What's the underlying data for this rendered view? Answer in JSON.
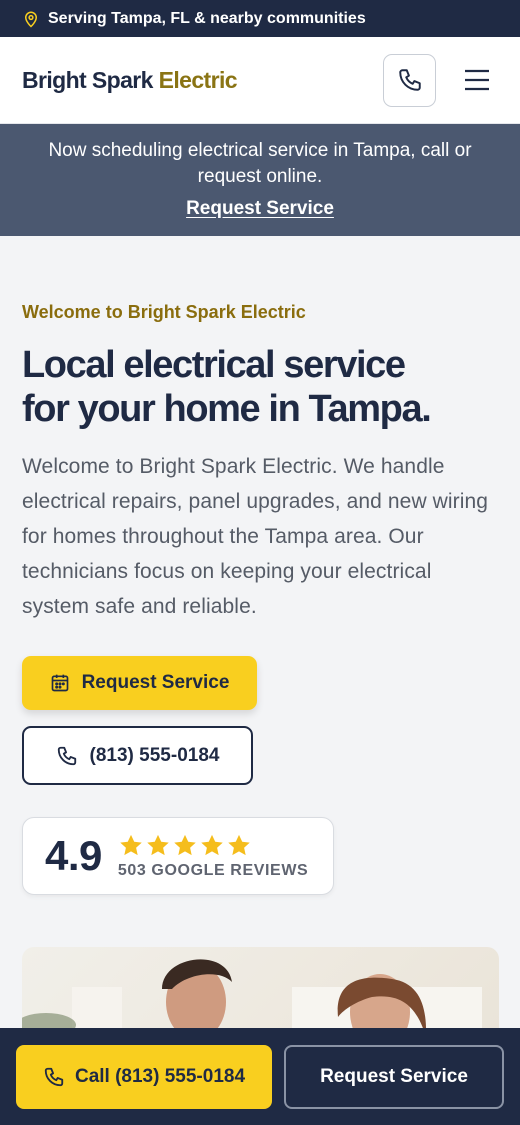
{
  "topbar": {
    "text": "Serving Tampa, FL & nearby communities",
    "icon": "map-pin-icon"
  },
  "header": {
    "logo_part1": "Bright Spark",
    "logo_part2": "Electric",
    "call_icon": "phone-icon",
    "menu_icon": "hamburger-menu-icon"
  },
  "announcement": {
    "text": "Now scheduling electrical service in Tampa, call or request online.",
    "link_label": "Request Service"
  },
  "hero": {
    "eyebrow": "Welcome to Bright Spark Electric",
    "headline_line1": "Local electrical service",
    "headline_line2": "for your home in Tampa.",
    "body": "Welcome to Bright Spark Electric. We handle electrical repairs, panel upgrades, and new wiring for homes throughout the Tampa area. Our technicians focus on keeping your electrical system safe and reliable.",
    "primary_button": "Request Service",
    "phone_button": "(813) 555-0184"
  },
  "rating": {
    "value": "4.9",
    "stars": 5,
    "label": "503 GOOGLE REVIEWS"
  },
  "bottom_bar": {
    "call_label": "Call (813) 555-0184",
    "request_label": "Request Service"
  },
  "colors": {
    "navy": "#1f2a44",
    "gold": "#8a7414",
    "yellow": "#f9cf1f",
    "star": "#f5bd1c",
    "slate": "#4b5870"
  }
}
